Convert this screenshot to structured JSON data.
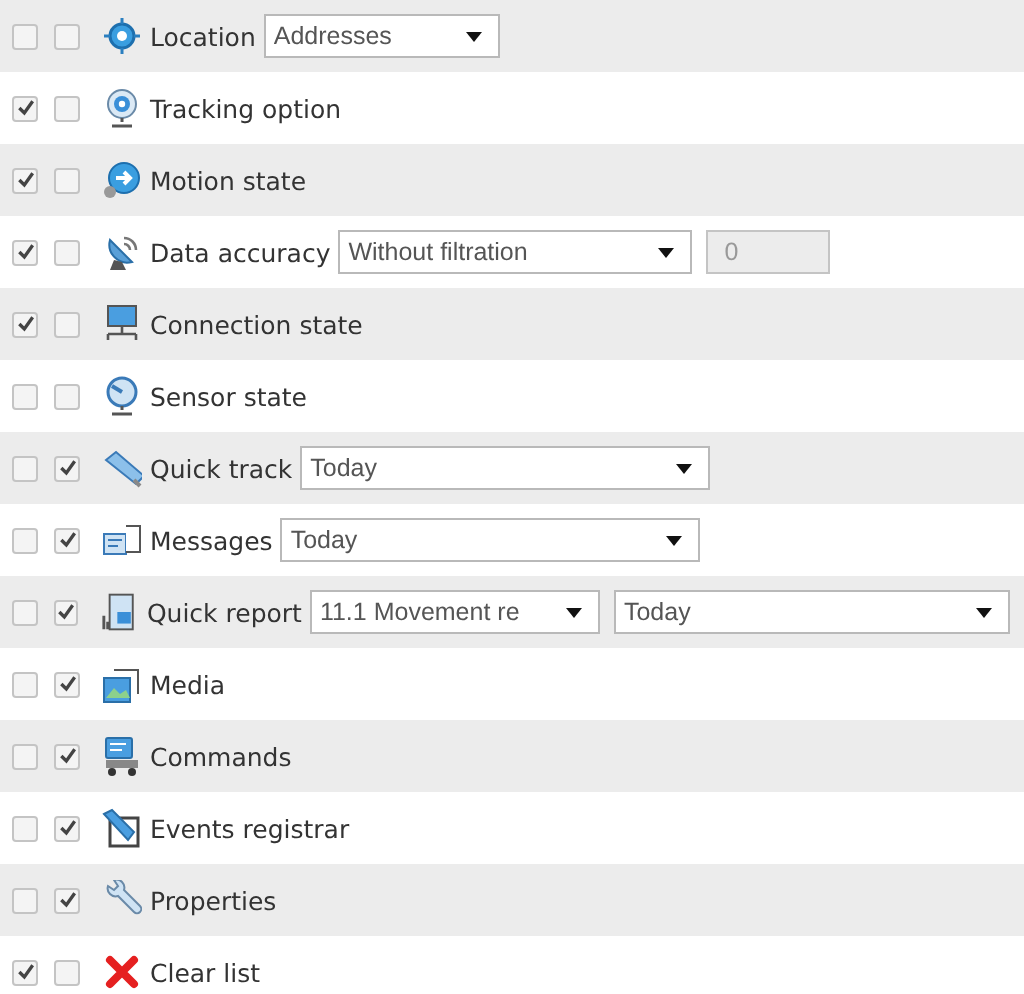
{
  "rows": [
    {
      "label": "Location",
      "checkboxes": [
        {
          "checked": false
        },
        {
          "checked": false
        }
      ],
      "controls": [
        {
          "kind": "select",
          "value": "Addresses"
        }
      ]
    },
    {
      "label": "Tracking option",
      "checkboxes": [
        {
          "checked": true
        },
        {
          "checked": false
        }
      ]
    },
    {
      "label": "Motion state",
      "checkboxes": [
        {
          "checked": true
        },
        {
          "checked": false
        }
      ]
    },
    {
      "label": "Data accuracy",
      "checkboxes": [
        {
          "checked": true
        },
        {
          "checked": false
        }
      ],
      "controls": [
        {
          "kind": "select",
          "value": "Without filtration"
        },
        {
          "kind": "number",
          "value": "0",
          "disabled": true
        }
      ]
    },
    {
      "label": "Connection state",
      "checkboxes": [
        {
          "checked": true
        },
        {
          "checked": false
        }
      ]
    },
    {
      "label": "Sensor state",
      "checkboxes": [
        {
          "checked": false
        },
        {
          "checked": false
        }
      ]
    },
    {
      "label": "Quick track",
      "checkboxes": [
        {
          "checked": false
        },
        {
          "checked": true
        }
      ],
      "controls": [
        {
          "kind": "select",
          "value": "Today"
        }
      ]
    },
    {
      "label": "Messages",
      "checkboxes": [
        {
          "checked": false
        },
        {
          "checked": true
        }
      ],
      "controls": [
        {
          "kind": "select",
          "value": "Today"
        }
      ]
    },
    {
      "label": "Quick report",
      "checkboxes": [
        {
          "checked": false
        },
        {
          "checked": true
        }
      ],
      "controls": [
        {
          "kind": "select",
          "value": "11.1 Movement re"
        },
        {
          "kind": "select",
          "value": "Today"
        }
      ]
    },
    {
      "label": "Media",
      "checkboxes": [
        {
          "checked": false
        },
        {
          "checked": true
        }
      ]
    },
    {
      "label": "Commands",
      "checkboxes": [
        {
          "checked": false
        },
        {
          "checked": true
        }
      ]
    },
    {
      "label": "Events registrar",
      "checkboxes": [
        {
          "checked": false
        },
        {
          "checked": true
        }
      ]
    },
    {
      "label": "Properties",
      "checkboxes": [
        {
          "checked": false
        },
        {
          "checked": true
        }
      ]
    },
    {
      "label": "Clear list",
      "checkboxes": [
        {
          "checked": true
        },
        {
          "checked": false
        }
      ]
    }
  ]
}
